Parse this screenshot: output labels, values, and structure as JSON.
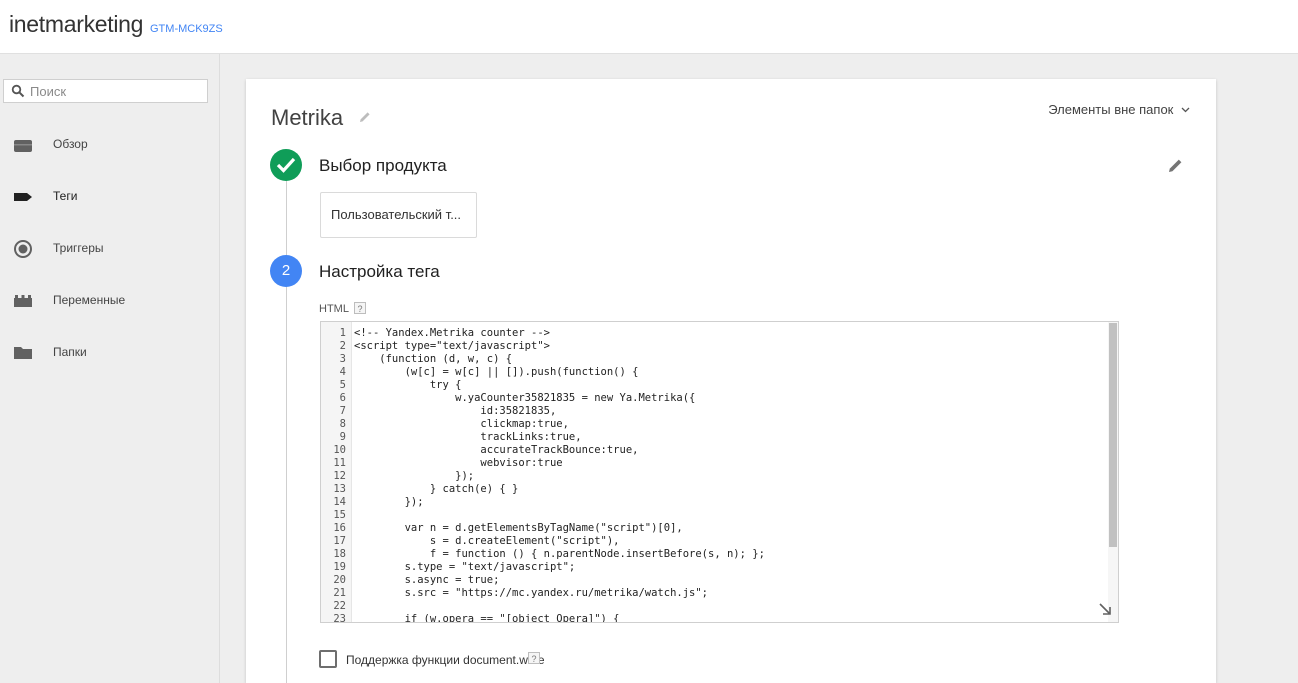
{
  "header": {
    "account_name": "inetmarketing",
    "container_id": "GTM-MCK9ZS"
  },
  "sidebar": {
    "search": {
      "placeholder": "Поиск",
      "value": ""
    },
    "items": [
      {
        "label": "Обзор",
        "icon": "briefcase-icon"
      },
      {
        "label": "Теги",
        "icon": "tag-icon",
        "active": true
      },
      {
        "label": "Триггеры",
        "icon": "trigger-icon"
      },
      {
        "label": "Переменные",
        "icon": "blocks-icon"
      },
      {
        "label": "Папки",
        "icon": "folder-icon"
      }
    ]
  },
  "editor": {
    "tag_name": "Metrika",
    "folder_dropdown": "Элементы вне папок",
    "step1": {
      "title": "Выбор продукта",
      "product": "Пользовательский т..."
    },
    "step2": {
      "number": "2",
      "title": "Настройка тега",
      "html_label": "HTML",
      "help": "?"
    },
    "code": {
      "line_numbers": [
        "1",
        "2",
        "3",
        "4",
        "5",
        "6",
        "7",
        "8",
        "9",
        "10",
        "11",
        "12",
        "13",
        "14",
        "15",
        "16",
        "17",
        "18",
        "19",
        "20",
        "21",
        "22",
        "23"
      ],
      "lines": [
        "<!-- Yandex.Metrika counter -->",
        "<script type=\"text/javascript\">",
        "    (function (d, w, c) {",
        "        (w[c] = w[c] || []).push(function() {",
        "            try {",
        "                w.yaCounter35821835 = new Ya.Metrika({",
        "                    id:35821835,",
        "                    clickmap:true,",
        "                    trackLinks:true,",
        "                    accurateTrackBounce:true,",
        "                    webvisor:true",
        "                });",
        "            } catch(e) { }",
        "        });",
        "",
        "        var n = d.getElementsByTagName(\"script\")[0],",
        "            s = d.createElement(\"script\"),",
        "            f = function () { n.parentNode.insertBefore(s, n); };",
        "        s.type = \"text/javascript\";",
        "        s.async = true;",
        "        s.src = \"https://mc.yandex.ru/metrika/watch.js\";",
        "",
        "        if (w.opera == \"[object Opera]\") {"
      ]
    },
    "document_write": {
      "label": "Поддержка функции document.write",
      "checked": false,
      "help": "?"
    }
  },
  "colors": {
    "accent_blue": "#4285f4",
    "success_green": "#0f9d58"
  }
}
